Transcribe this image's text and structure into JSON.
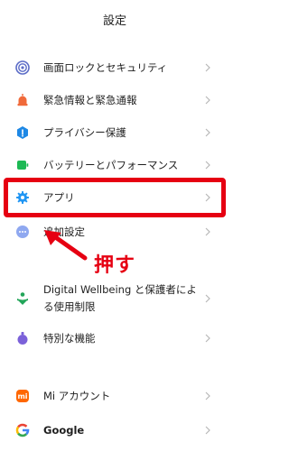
{
  "header": {
    "title": "設定"
  },
  "items": [
    {
      "label": "画面ロックとセキュリティ",
      "icon": "lock-icon"
    },
    {
      "label": "緊急情報と緊急通報",
      "icon": "alarm-icon"
    },
    {
      "label": "プライバシー保護",
      "icon": "privacy-icon"
    },
    {
      "label": "バッテリーとパフォーマンス",
      "icon": "battery-icon"
    },
    {
      "label": "アプリ",
      "icon": "gear-icon"
    },
    {
      "label": "追加設定",
      "icon": "more-icon"
    },
    {
      "label_line1": "Digital Wellbeing と保護者によ",
      "label_line2": "る使用制限",
      "icon": "wellbeing-icon"
    },
    {
      "label": "特別な機能",
      "icon": "special-features-icon"
    },
    {
      "label": "Mi アカウント",
      "icon": "mi-icon",
      "icon_text": "mi"
    },
    {
      "label": "Google",
      "icon": "google-icon"
    }
  ],
  "annotation": {
    "text": "押す"
  },
  "colors": {
    "accent": "#e60012",
    "lock": "#5b6cc7",
    "alarm": "#f06a3a",
    "privacy": "#1e88e5",
    "battery": "#1db954",
    "gear": "#2196f3",
    "more": "#8fa8f0",
    "wellbeing": "#22a559",
    "special": "#7b61d9",
    "mi": "#ff6700"
  }
}
